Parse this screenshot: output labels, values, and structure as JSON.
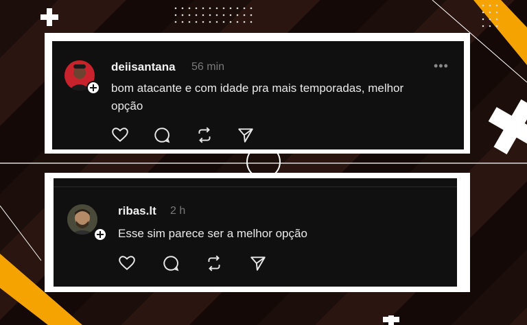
{
  "comments": [
    {
      "username": "deiisantana",
      "time": "56 min",
      "text": "bom atacante e com idade pra mais temporadas, melhor opção",
      "more_label": "•••"
    },
    {
      "username": "ribas.lt",
      "time": "2 h",
      "text": "Esse sim parece ser a melhor opção"
    }
  ],
  "icons": {
    "like": "heart-icon",
    "reply": "comment-icon",
    "repost": "repost-icon",
    "share": "send-icon",
    "follow": "plus-icon",
    "more": "more-icon"
  },
  "colors": {
    "card_bg": "#101010",
    "frame": "#ffffff",
    "accent_yellow": "#f5a300",
    "muted": "#7a7a7a"
  }
}
